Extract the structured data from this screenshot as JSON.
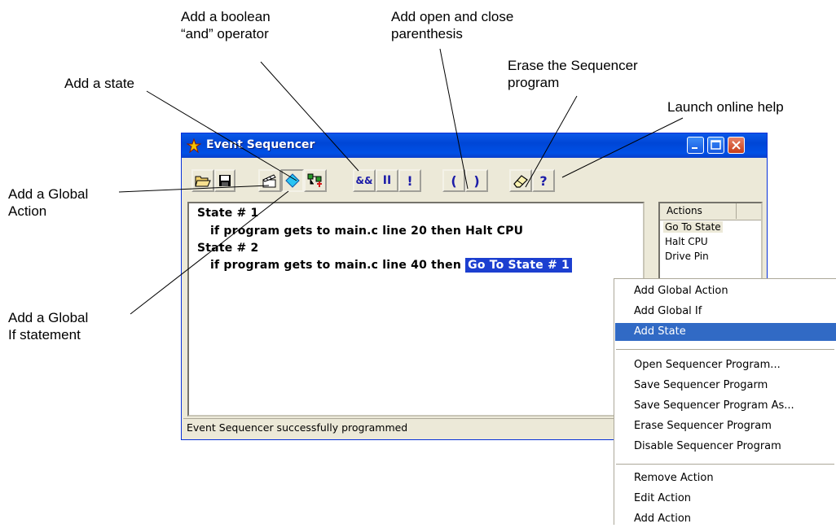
{
  "callouts": {
    "boolean_and": "Add a boolean\n“and” operator",
    "parenthesis": "Add open and close\nparenthesis",
    "erase": "Erase the Sequencer\nprogram",
    "add_state": "Add a state",
    "help": "Launch online help",
    "global_action": "Add a Global\nAction",
    "global_if": "Add a Global\nIf statement"
  },
  "window": {
    "title": "Event Sequencer",
    "icon": "ti-star-icon"
  },
  "toolbar": [
    {
      "name": "open-folder-icon",
      "label": ""
    },
    {
      "name": "save-icon",
      "label": ""
    },
    {
      "name": "clapboard-icon",
      "label": ""
    },
    {
      "name": "diamond-icon",
      "label": ""
    },
    {
      "name": "add-state-icon",
      "label": ""
    },
    {
      "name": "and-operator",
      "label": "&&"
    },
    {
      "name": "or-operator",
      "label": "II"
    },
    {
      "name": "not-operator",
      "label": "!"
    },
    {
      "name": "open-paren",
      "label": "("
    },
    {
      "name": "close-paren",
      "label": ")"
    },
    {
      "name": "eraser-icon",
      "label": ""
    },
    {
      "name": "help-icon",
      "label": "?"
    }
  ],
  "program": {
    "state1": "State # 1",
    "line1": "if program gets to main.c line 20 then Halt CPU",
    "state2": "State # 2",
    "line2": "if program gets to main.c line 40 then",
    "line2_action": "Go To State # 1"
  },
  "actions": {
    "header": "Actions",
    "items": [
      "Go To State",
      "Halt CPU",
      "Drive Pin"
    ]
  },
  "status": "Event Sequencer successfully programmed",
  "context_menu": {
    "group1": [
      "Add Global Action",
      "Add Global If",
      "Add State"
    ],
    "group2": [
      "Open Sequencer Program...",
      "Save Sequencer Progarm",
      "Save Sequencer Program As...",
      "Erase Sequencer Program",
      "Disable Sequencer Program"
    ],
    "group3": [
      "Remove Action",
      "Edit Action",
      "Add Action"
    ],
    "highlighted": "Add State"
  },
  "colors": {
    "titlebar": "#0050e6",
    "selection": "#316ac5",
    "highlight_text_bg": "#1c3fd0",
    "toolbar_glyph": "#1c1ca8"
  }
}
